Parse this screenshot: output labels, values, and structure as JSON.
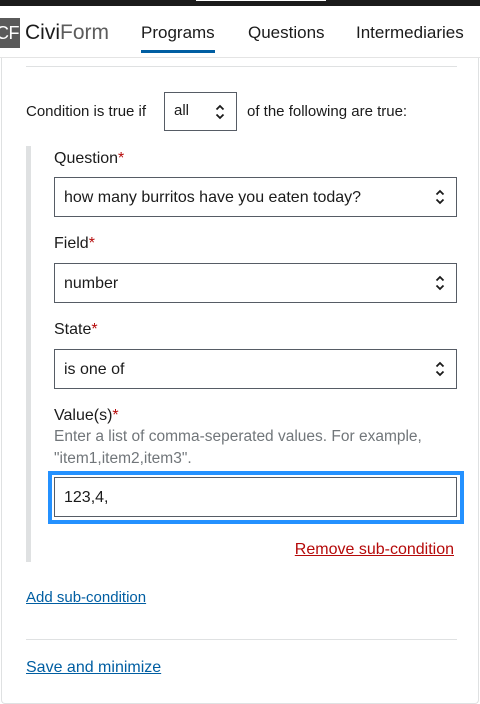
{
  "nav": {
    "logo_mark": "CF",
    "logo_civi": "Civi",
    "logo_form": "Form",
    "tabs": [
      {
        "label": "Programs",
        "active": true
      },
      {
        "label": "Questions",
        "active": false
      },
      {
        "label": "Intermediaries",
        "active": false
      }
    ]
  },
  "condition": {
    "prefix": "Condition is true if",
    "operator": "all",
    "suffix": "of the following are true:"
  },
  "subcondition": {
    "question": {
      "label": "Question",
      "required_mark": "*",
      "value": "how many burritos have you eaten today?"
    },
    "field": {
      "label": "Field",
      "required_mark": "*",
      "value": "number"
    },
    "state": {
      "label": "State",
      "required_mark": "*",
      "value": "is one of"
    },
    "values": {
      "label": "Value(s)",
      "required_mark": "*",
      "hint": "Enter a list of comma-seperated values. For example, \"item1,item2,item3\".",
      "value": "123,4,"
    },
    "remove_label": "Remove sub-condition"
  },
  "actions": {
    "add_label": "Add sub-condition",
    "save_label": "Save and minimize"
  },
  "colors": {
    "link": "#005ea2",
    "danger": "#b50909",
    "focus": "#2491ff",
    "active_tab": "#005ea2"
  },
  "icons": {
    "select_chevron": "chevron-up-down-icon"
  }
}
